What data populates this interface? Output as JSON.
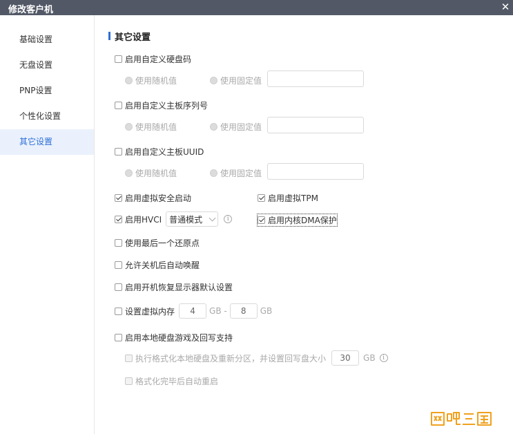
{
  "window": {
    "title": "修改客户机",
    "close_glyph": "✕"
  },
  "sidebar": {
    "items": [
      {
        "label": "基础设置"
      },
      {
        "label": "无盘设置"
      },
      {
        "label": "PNP设置"
      },
      {
        "label": "个性化设置"
      },
      {
        "label": "其它设置",
        "active": true
      }
    ]
  },
  "section": {
    "title": "其它设置"
  },
  "options": {
    "custom_disk_code": {
      "label": "启用自定义硬盘码",
      "checked": false
    },
    "custom_board_serial": {
      "label": "启用自定义主板序列号",
      "checked": false
    },
    "custom_board_uuid": {
      "label": "启用自定义主板UUID",
      "checked": false
    },
    "radio_random": "使用随机值",
    "radio_fixed": "使用固定值",
    "virtual_secure_boot": {
      "label": "启用虚拟安全启动",
      "checked": true
    },
    "virtual_tpm": {
      "label": "启用虚拟TPM",
      "checked": true
    },
    "hvci": {
      "label": "启用HVCI",
      "checked": true,
      "mode": "普通模式"
    },
    "kernel_dma": {
      "label": "启用内核DMA保护",
      "checked": true
    },
    "last_restore_point": {
      "label": "使用最后一个还原点",
      "checked": false
    },
    "wake_after_shutdown": {
      "label": "允许关机后自动唤醒",
      "checked": false
    },
    "restore_display_defaults": {
      "label": "启用开机恢复显示器默认设置",
      "checked": false
    },
    "virtual_memory": {
      "label": "设置虚拟内存",
      "checked": false,
      "min": "4",
      "max": "8",
      "unit_min": "GB -",
      "unit_max": "GB"
    },
    "local_disk_game": {
      "label": "启用本地硬盘游戏及回写支持",
      "checked": false
    },
    "format_local_disk": {
      "label": "执行格式化本地硬盘及重新分区，并设置回写盘大小",
      "value": "30",
      "unit": "GB"
    },
    "reboot_after_format": {
      "label": "格式化完毕后自动重启"
    }
  },
  "watermark": {
    "text": "网吧三国",
    "color": "#f0a11e"
  }
}
